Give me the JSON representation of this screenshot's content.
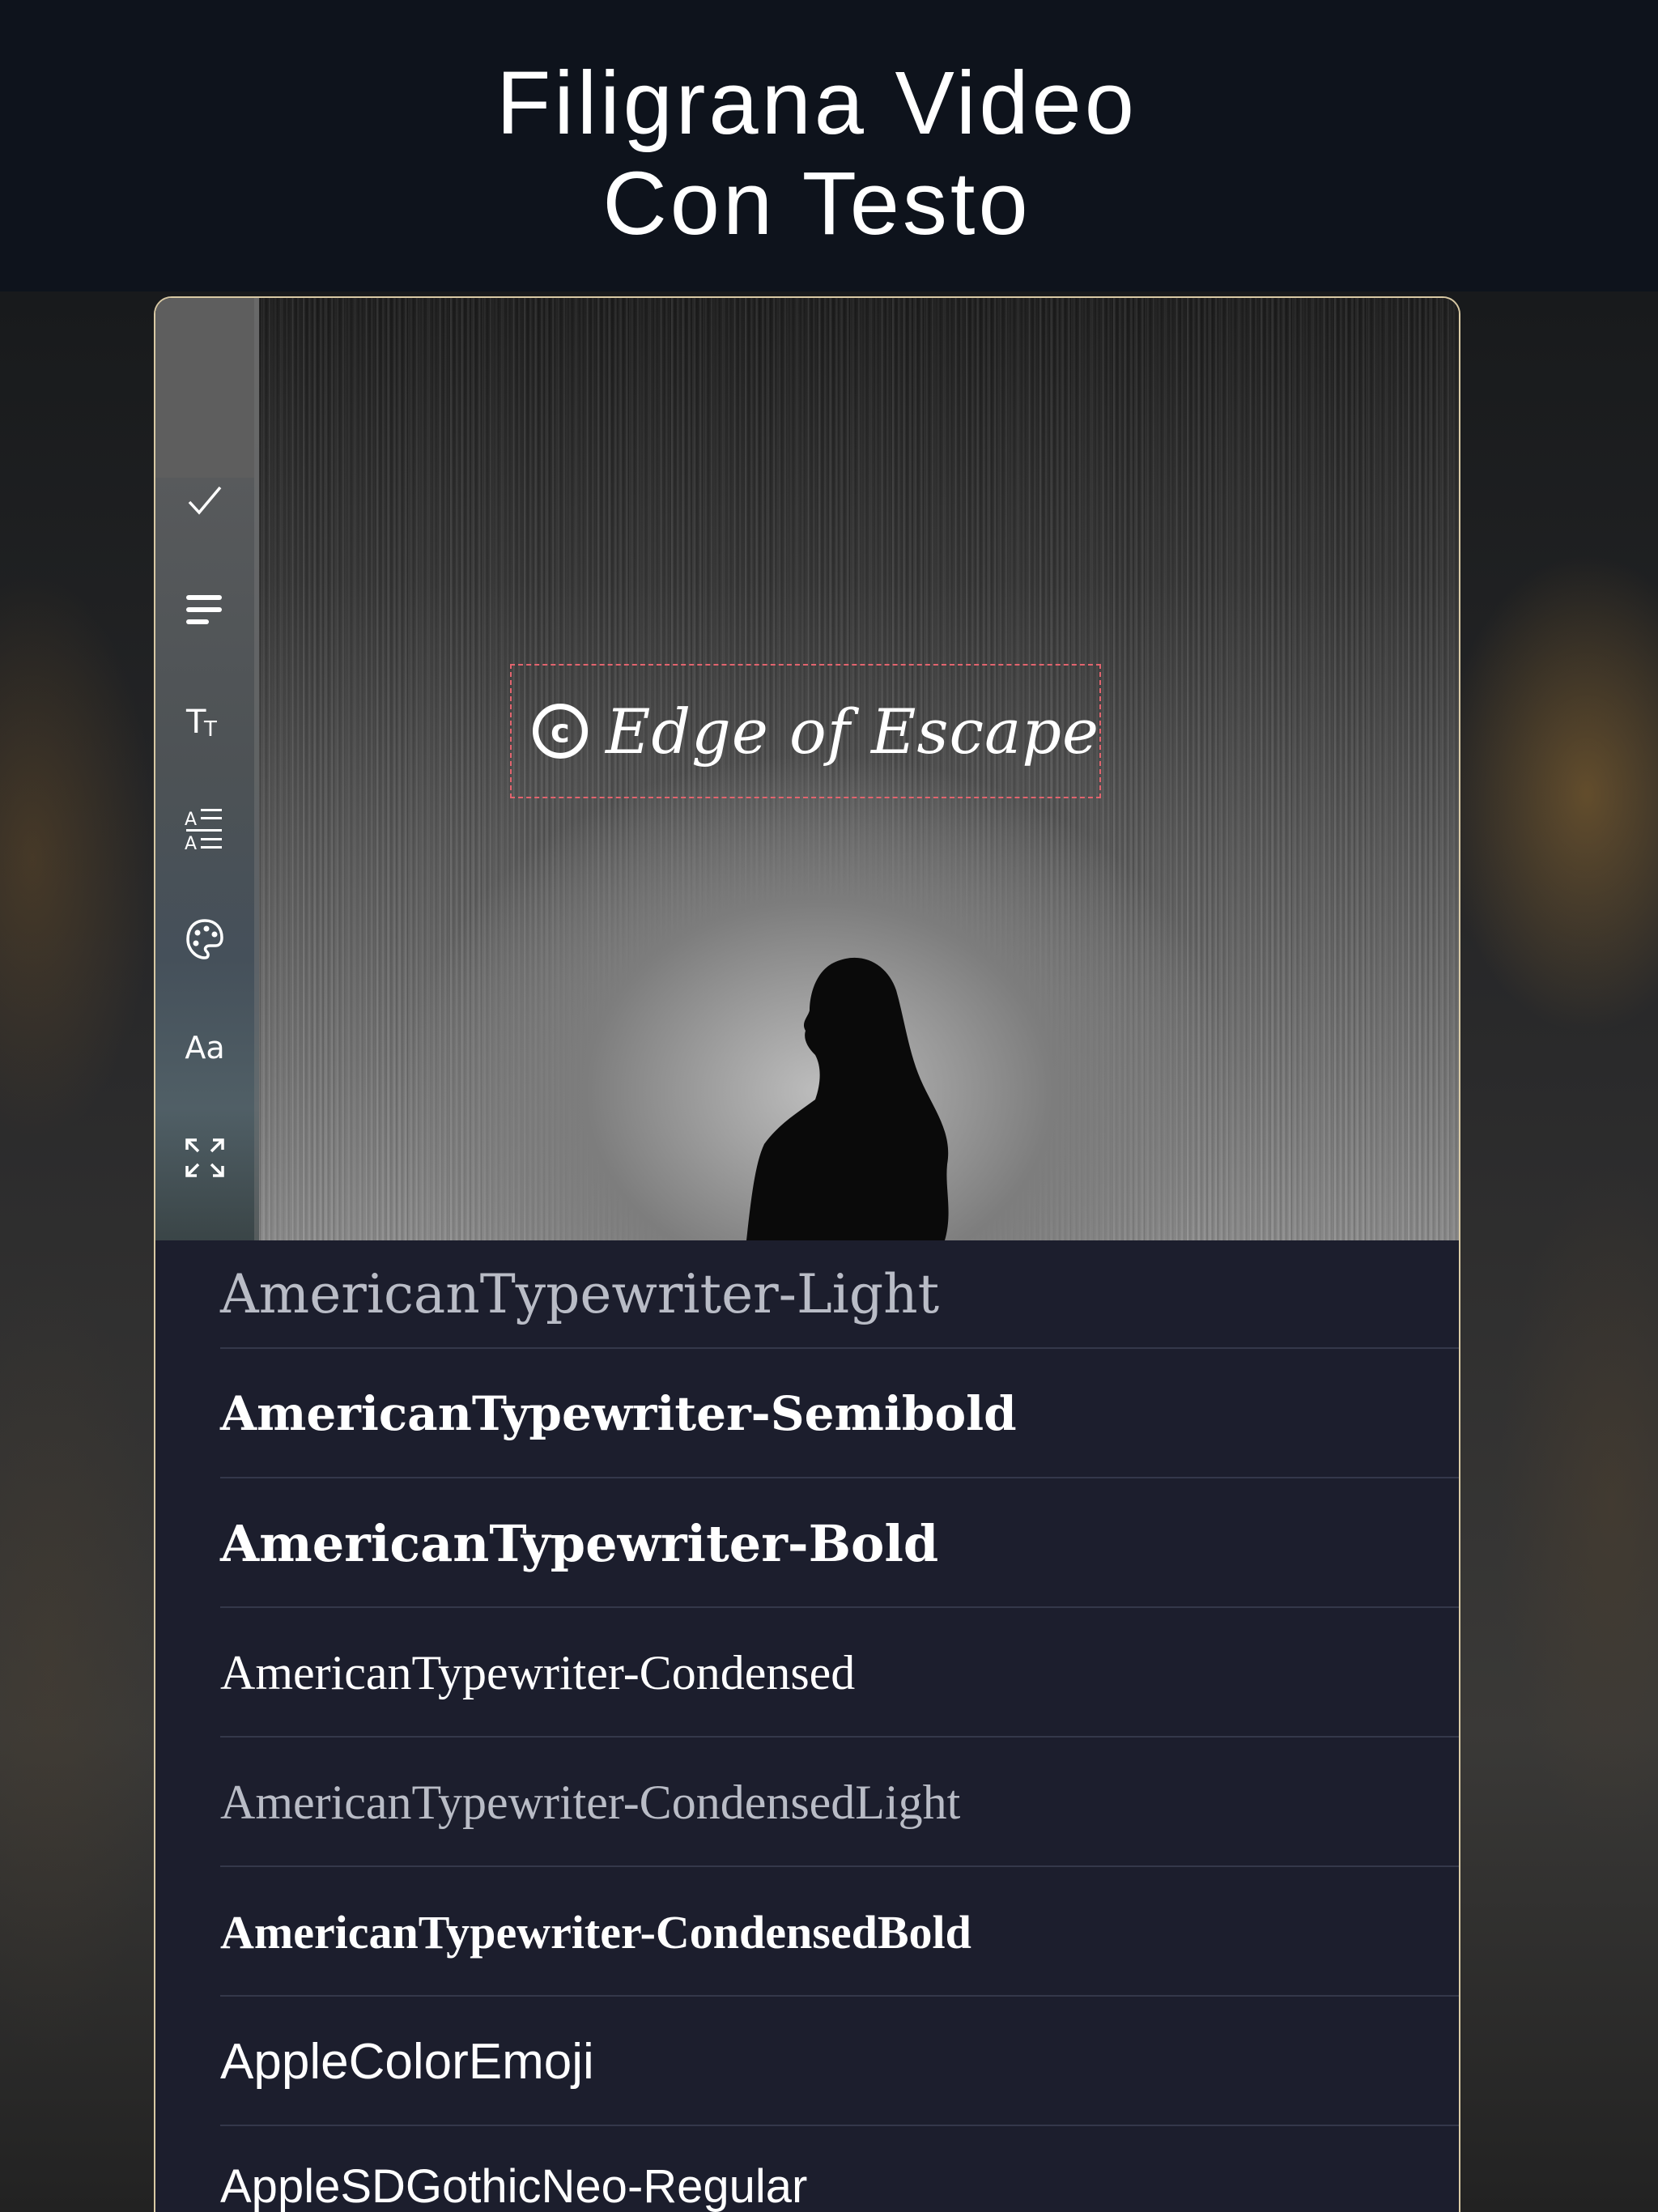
{
  "headline": {
    "line1": "Filigrana Video",
    "line2": "Con Testo"
  },
  "watermark": {
    "symbol": "©",
    "text": "Edge of Escape"
  },
  "sidebar": {
    "tools": [
      {
        "icon": "checkmark-icon"
      },
      {
        "icon": "text-align-icon"
      },
      {
        "icon": "text-size-icon"
      },
      {
        "icon": "line-spacing-icon"
      },
      {
        "icon": "color-palette-icon"
      },
      {
        "icon": "font-icon",
        "label": "Aa"
      },
      {
        "icon": "expand-icon"
      }
    ]
  },
  "font_list": {
    "items": [
      "AmericanTypewriter-Light",
      "AmericanTypewriter-Semibold",
      "AmericanTypewriter-Bold",
      "AmericanTypewriter-Condensed",
      "AmericanTypewriter-CondensedLight",
      "AmericanTypewriter-CondensedBold",
      "AppleColorEmoji",
      "AppleSDGothicNeo-Regular"
    ]
  },
  "colors": {
    "background": "#0e131c",
    "panel": "#1c1e2d",
    "selection_border": "#e2646e",
    "device_frame": "#d8c9a4"
  }
}
